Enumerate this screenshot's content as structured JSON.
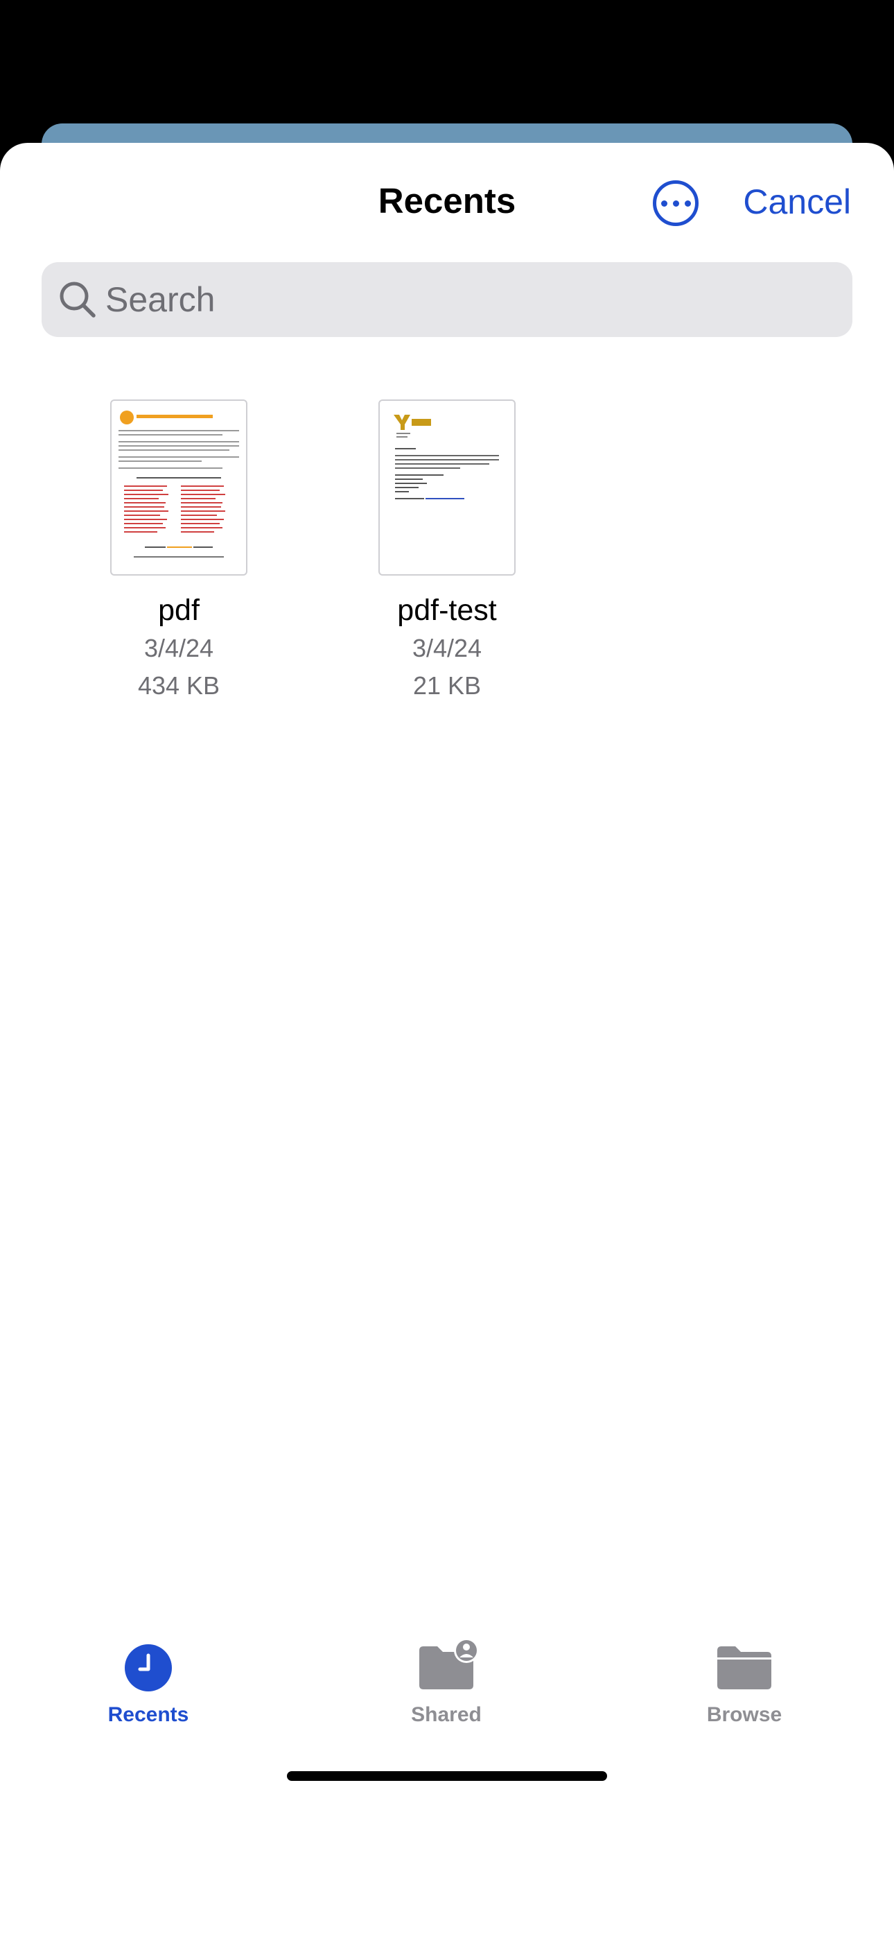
{
  "header": {
    "title": "Recents",
    "more_icon": "ellipsis-circle-icon",
    "cancel_label": "Cancel"
  },
  "search": {
    "placeholder": "Search",
    "value": "",
    "icon": "search-icon"
  },
  "files": [
    {
      "name": "pdf",
      "date": "3/4/24",
      "size": "434 KB"
    },
    {
      "name": "pdf-test",
      "date": "3/4/24",
      "size": "21 KB"
    }
  ],
  "tabs": [
    {
      "label": "Recents",
      "icon": "clock-icon",
      "selected": true
    },
    {
      "label": "Shared",
      "icon": "shared-folder-icon",
      "selected": false
    },
    {
      "label": "Browse",
      "icon": "folder-icon",
      "selected": false
    }
  ],
  "colors": {
    "accent": "#1f4ecf",
    "tab_inactive": "#8e8e93",
    "search_fill": "#e6e6e9",
    "backdrop_card": "#6a96b6"
  }
}
